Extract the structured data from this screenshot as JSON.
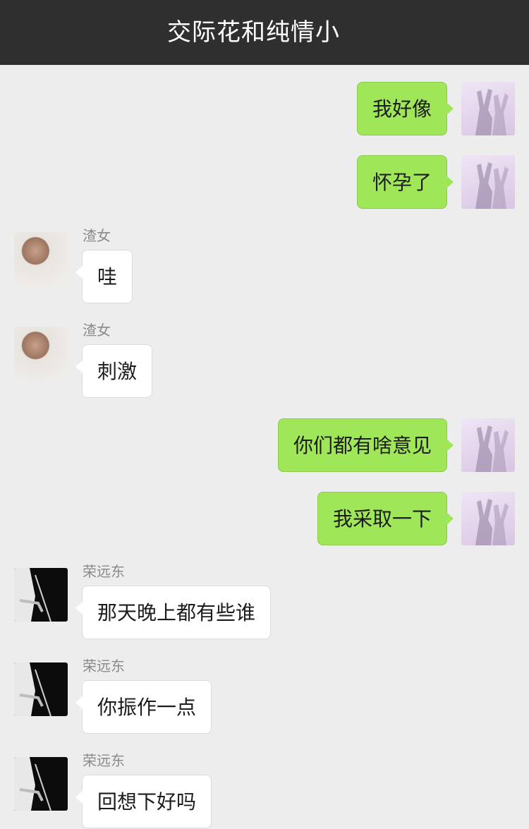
{
  "header": {
    "title": "交际花和纯情小"
  },
  "messages": [
    {
      "side": "right",
      "text": "我好像",
      "avatar": "bunny-shadow-avatar"
    },
    {
      "side": "right",
      "text": "怀孕了",
      "avatar": "bunny-shadow-avatar"
    },
    {
      "side": "left",
      "sender": "渣女",
      "text": "哇",
      "avatar": "girl-avatar"
    },
    {
      "side": "left",
      "sender": "渣女",
      "text": "刺激",
      "avatar": "girl-avatar"
    },
    {
      "side": "right",
      "text": "你们都有啥意见",
      "avatar": "bunny-shadow-avatar"
    },
    {
      "side": "right",
      "text": "我采取一下",
      "avatar": "bunny-shadow-avatar"
    },
    {
      "side": "left",
      "sender": "荣远东",
      "text": "那天晚上都有些谁",
      "avatar": "dark-avatar"
    },
    {
      "side": "left",
      "sender": "荣远东",
      "text": "你振作一点",
      "avatar": "dark-avatar"
    },
    {
      "side": "left",
      "sender": "荣远东",
      "text": "回想下好吗",
      "avatar": "dark-avatar"
    }
  ],
  "colors": {
    "header_bg": "#2f2f30",
    "chat_bg": "#ededed",
    "outgoing_bubble": "#9fe658",
    "incoming_bubble": "#ffffff"
  }
}
